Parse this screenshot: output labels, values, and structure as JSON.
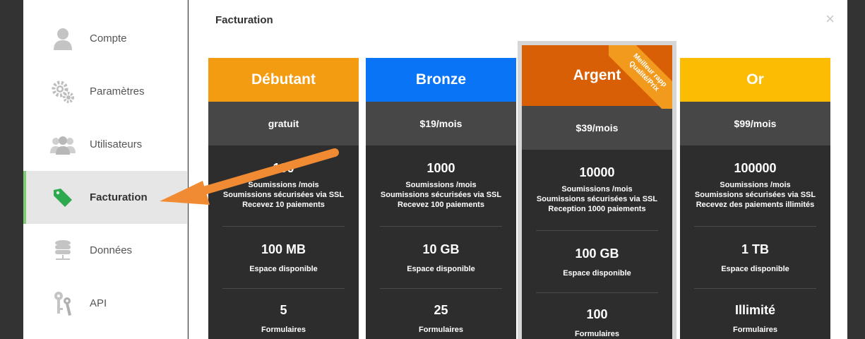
{
  "sidebar": {
    "items": [
      {
        "label": "Compte",
        "icon": "user-icon"
      },
      {
        "label": "Paramètres",
        "icon": "gears-icon"
      },
      {
        "label": "Utilisateurs",
        "icon": "users-icon"
      },
      {
        "label": "Facturation",
        "icon": "tag-icon",
        "active": true
      },
      {
        "label": "Données",
        "icon": "database-icon"
      },
      {
        "label": "API",
        "icon": "keys-icon"
      }
    ]
  },
  "main": {
    "title": "Facturation",
    "close": "×"
  },
  "plans": [
    {
      "name": "Débutant",
      "color": "#f39c12",
      "price": "gratuit",
      "submissions": "100",
      "sub_lines": [
        "Soumissions /mois",
        "Soumissions sécurisées via SSL",
        "Recevez 10 paiements"
      ],
      "storage": "100 MB",
      "storage_label": "Espace disponible",
      "forms": "5",
      "forms_label": "Formulaires"
    },
    {
      "name": "Bronze",
      "color": "#0a74f7",
      "price": "$19/mois",
      "submissions": "1000",
      "sub_lines": [
        "Soumissions /mois",
        "Soumissions sécurisées via SSL",
        "Recevez 100 paiements"
      ],
      "storage": "10 GB",
      "storage_label": "Espace disponible",
      "forms": "25",
      "forms_label": "Formulaires"
    },
    {
      "name": "Argent",
      "color": "#d95f06",
      "price": "$39/mois",
      "ribbon": [
        "Meilleur rapp",
        "Qualité/Prix"
      ],
      "submissions": "10000",
      "sub_lines": [
        "Soumissions /mois",
        "Soumissions sécurisées via SSL",
        "Reception 1000 paiements"
      ],
      "storage": "100 GB",
      "storage_label": "Espace disponible",
      "forms": "100",
      "forms_label": "Formulaires"
    },
    {
      "name": "Or",
      "color": "#fcbc04",
      "price": "$99/mois",
      "submissions": "100000",
      "sub_lines": [
        "Soumissions /mois",
        "Soumissions sécurisées via SSL",
        "Recevez des paiements illimités"
      ],
      "storage": "1 TB",
      "storage_label": "Espace disponible",
      "forms": "Illimité",
      "forms_label": "Formulaires"
    }
  ],
  "colors": {
    "accent_arrow": "#f08a33",
    "active_bar": "#7ccc73",
    "tag_icon": "#2eaa4e"
  }
}
